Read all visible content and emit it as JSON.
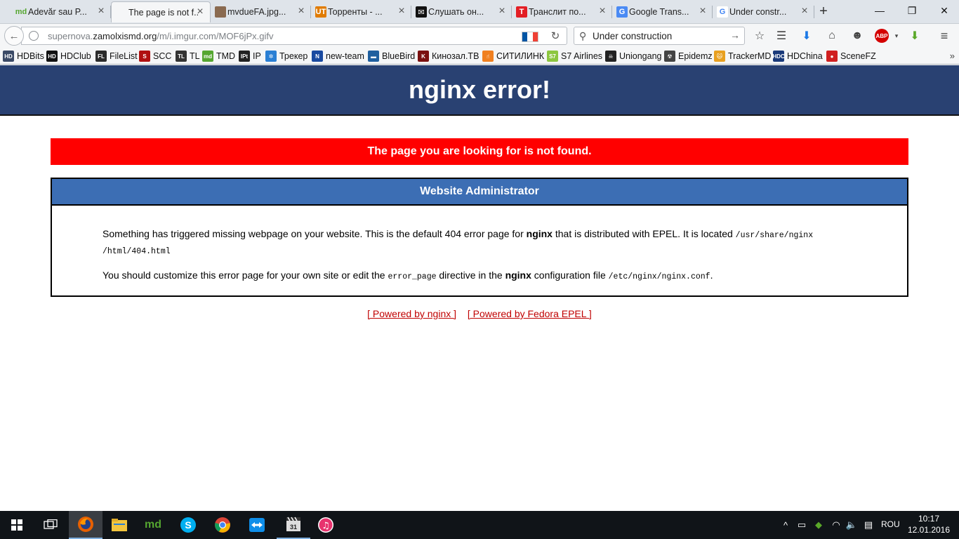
{
  "browser": {
    "tabs": [
      {
        "label": "Adevăr sau P...",
        "favicon": "md-icon",
        "color": "#55a630",
        "fav_text": "md",
        "active": false
      },
      {
        "label": "The page is not f...",
        "favicon": "blank-page-icon",
        "color": "",
        "fav_text": "",
        "active": true
      },
      {
        "label": "mvdueFA.jpg...",
        "favicon": "image-thumb-icon",
        "color": "#8a6a50",
        "fav_text": "",
        "active": false
      },
      {
        "label": "Торренты - ...",
        "favicon": "torrent-site-icon",
        "color": "#e07b00",
        "fav_text": "UT",
        "active": false
      },
      {
        "label": "Слушать он...",
        "favicon": "music-site-icon",
        "color": "#111111",
        "fav_text": "✉",
        "active": false
      },
      {
        "label": "Транслит по...",
        "favicon": "translit-icon",
        "color": "#e31e24",
        "fav_text": "T",
        "active": false
      },
      {
        "label": "Google Trans...",
        "favicon": "google-translate-icon",
        "color": "#4a8af4",
        "fav_text": "G",
        "active": false
      },
      {
        "label": "Under constr...",
        "favicon": "google-icon",
        "color": "#ffffff",
        "fav_text": "G",
        "active": false
      }
    ],
    "url": {
      "host_prefix": "supernova.",
      "host": "zamolxismd.org",
      "path": "/m/i.imgur.com/MOF6jPx.gifv"
    },
    "search_value": "Under construction",
    "window_controls": {
      "minimize": "—",
      "maximize": "❐",
      "close": "✕"
    },
    "bookmarks": [
      {
        "label": "HDBits",
        "icon": "hdbits-icon",
        "color": "#3b4a66",
        "abbr": "HD"
      },
      {
        "label": "HDClub",
        "icon": "hdclub-icon",
        "color": "#111111",
        "abbr": "HD"
      },
      {
        "label": "FileList",
        "icon": "filelist-icon",
        "color": "#2b2b2b",
        "abbr": "FL"
      },
      {
        "label": "SCC",
        "icon": "scc-icon",
        "color": "#b01010",
        "abbr": "S"
      },
      {
        "label": "TL",
        "icon": "tl-icon",
        "color": "#333333",
        "abbr": "TL"
      },
      {
        "label": "TMD",
        "icon": "tmd-icon",
        "color": "#55a630",
        "abbr": "md"
      },
      {
        "label": "IP",
        "icon": "ip-icon",
        "color": "#222222",
        "abbr": "IPt"
      },
      {
        "label": "Трекер",
        "icon": "tracker-icon",
        "color": "#2a7fd4",
        "abbr": "✲"
      },
      {
        "label": "new-team",
        "icon": "newteam-icon",
        "color": "#1a4aa0",
        "abbr": "N"
      },
      {
        "label": "BlueBird",
        "icon": "bluebird-icon",
        "color": "#1f5f9f",
        "abbr": "▬"
      },
      {
        "label": "Кинозал.ТВ",
        "icon": "kinozal-icon",
        "color": "#7a1010",
        "abbr": "K"
      },
      {
        "label": "СИТИЛИНК",
        "icon": "citilink-icon",
        "color": "#f08020",
        "abbr": "☝"
      },
      {
        "label": "S7 Airlines",
        "icon": "s7-icon",
        "color": "#8cc63f",
        "abbr": "S7"
      },
      {
        "label": "Uniongang",
        "icon": "uniongang-icon",
        "color": "#222222",
        "abbr": "☠"
      },
      {
        "label": "Epidemz",
        "icon": "epidemz-icon",
        "color": "#444444",
        "abbr": "☢"
      },
      {
        "label": "TrackerMD",
        "icon": "trackermd-icon",
        "color": "#e8a020",
        "abbr": "🐱"
      },
      {
        "label": "HDChina",
        "icon": "hdchina-icon",
        "color": "#1a3a7a",
        "abbr": "HDC"
      },
      {
        "label": "SceneFZ",
        "icon": "scenefz-icon",
        "color": "#d02020",
        "abbr": "●"
      }
    ]
  },
  "page": {
    "title": "nginx error!",
    "alert": "The page you are looking for is not found.",
    "box_header": "Website Administrator",
    "p1_a": "Something has triggered missing webpage on your website. This is the default 404 error page for ",
    "p1_b": "nginx",
    "p1_c": " that is distributed with EPEL. It is located ",
    "p1_path": "/usr/share/nginx /html/404.html",
    "p2_a": "You should customize this error page for your own site or edit the ",
    "p2_code": "error_page",
    "p2_b": " directive in the ",
    "p2_bold": "nginx",
    "p2_c": " configuration file ",
    "p2_path": "/etc/nginx/nginx.conf",
    "p2_end": ".",
    "links": [
      "[ Powered by nginx ]",
      "[ Powered by Fedora EPEL ]"
    ],
    "colors": {
      "banner": "#294172",
      "alert": "#ff0000",
      "box_header": "#3c6eb4",
      "link": "#c00000"
    }
  },
  "taskbar": {
    "apps": [
      "windows-start-icon",
      "task-view-icon",
      "firefox-icon",
      "file-explorer-icon",
      "md-app-icon",
      "skype-icon",
      "chrome-icon",
      "teamviewer-icon",
      "video-editor-icon",
      "itunes-icon"
    ],
    "language": "ROU",
    "time": "10:17",
    "date": "12.01.2016"
  }
}
